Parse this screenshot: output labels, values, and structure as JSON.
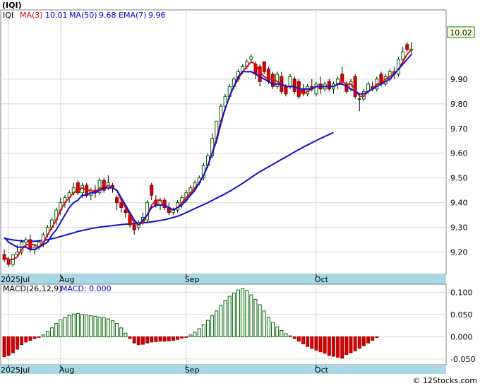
{
  "chart_data": [
    {
      "type": "candlestick",
      "title": "(IQI)",
      "legend": {
        "ticker": "IQI",
        "ma3_label": "MA(3)",
        "ma3_value": "10.01",
        "ma50_label": "MA(50)",
        "ma50_value": "9.68",
        "ema7_label": "EMA(7)",
        "ema7_value": "9.96"
      },
      "last_price_tag": "10.02",
      "ylim": [
        9.11,
        10.18
      ],
      "y_ticks": [
        {
          "value": 9.2,
          "label": "9.20"
        },
        {
          "value": 9.3,
          "label": "9.30"
        },
        {
          "value": 9.4,
          "label": "9.40"
        },
        {
          "value": 9.5,
          "label": "9.50"
        },
        {
          "value": 9.6,
          "label": "9.60"
        },
        {
          "value": 9.7,
          "label": "9.70"
        },
        {
          "value": 9.8,
          "label": "9.80"
        },
        {
          "value": 9.9,
          "label": "9.90"
        }
      ],
      "x_ticks": [
        {
          "label": "2025Jul",
          "bar": 1
        },
        {
          "label": "Aug",
          "bar": 13
        },
        {
          "label": "Sep",
          "bar": 42
        },
        {
          "label": "Oct",
          "bar": 72
        }
      ],
      "ohlc": [
        [
          9.19,
          9.21,
          9.16,
          9.17
        ],
        [
          9.17,
          9.18,
          9.14,
          9.15
        ],
        [
          9.15,
          9.19,
          9.14,
          9.19
        ],
        [
          9.19,
          9.23,
          9.18,
          9.2
        ],
        [
          9.2,
          9.25,
          9.19,
          9.24
        ],
        [
          9.24,
          9.26,
          9.22,
          9.25
        ],
        [
          9.25,
          9.27,
          9.2,
          9.21
        ],
        [
          9.21,
          9.23,
          9.19,
          9.22
        ],
        [
          9.22,
          9.25,
          9.21,
          9.24
        ],
        [
          9.24,
          9.28,
          9.22,
          9.27
        ],
        [
          9.27,
          9.31,
          9.26,
          9.3
        ],
        [
          9.3,
          9.34,
          9.29,
          9.33
        ],
        [
          9.33,
          9.38,
          9.31,
          9.37
        ],
        [
          9.37,
          9.42,
          9.35,
          9.4
        ],
        [
          9.4,
          9.43,
          9.38,
          9.42
        ],
        [
          9.42,
          9.45,
          9.4,
          9.44
        ],
        [
          9.44,
          9.48,
          9.43,
          9.46
        ],
        [
          9.48,
          9.49,
          9.43,
          9.44
        ],
        [
          9.44,
          9.48,
          9.42,
          9.47
        ],
        [
          9.47,
          9.48,
          9.42,
          9.43
        ],
        [
          9.43,
          9.46,
          9.41,
          9.45
        ],
        [
          9.45,
          9.47,
          9.42,
          9.44
        ],
        [
          9.44,
          9.5,
          9.43,
          9.49
        ],
        [
          9.49,
          9.5,
          9.44,
          9.45
        ],
        [
          9.46,
          9.51,
          9.45,
          9.48
        ],
        [
          9.47,
          9.48,
          9.44,
          9.46
        ],
        [
          9.42,
          9.43,
          9.37,
          9.4
        ],
        [
          9.4,
          9.42,
          9.36,
          9.38
        ],
        [
          9.37,
          9.38,
          9.34,
          9.36
        ],
        [
          9.35,
          9.36,
          9.3,
          9.31
        ],
        [
          9.31,
          9.33,
          9.27,
          9.29
        ],
        [
          9.3,
          9.33,
          9.29,
          9.32
        ],
        [
          9.32,
          9.36,
          9.31,
          9.34
        ],
        [
          9.33,
          9.41,
          9.32,
          9.4
        ],
        [
          9.47,
          9.48,
          9.41,
          9.43
        ],
        [
          9.41,
          9.43,
          9.38,
          9.39
        ],
        [
          9.39,
          9.42,
          9.37,
          9.41
        ],
        [
          9.41,
          9.42,
          9.37,
          9.38
        ],
        [
          9.38,
          9.4,
          9.35,
          9.36
        ],
        [
          9.36,
          9.38,
          9.35,
          9.37
        ],
        [
          9.37,
          9.41,
          9.36,
          9.4
        ],
        [
          9.4,
          9.43,
          9.38,
          9.42
        ],
        [
          9.41,
          9.45,
          9.4,
          9.44
        ],
        [
          9.44,
          9.47,
          9.43,
          9.46
        ],
        [
          9.46,
          9.49,
          9.45,
          9.48
        ],
        [
          9.48,
          9.51,
          9.47,
          9.5
        ],
        [
          9.5,
          9.56,
          9.49,
          9.55
        ],
        [
          9.55,
          9.6,
          9.54,
          9.59
        ],
        [
          9.59,
          9.68,
          9.58,
          9.66
        ],
        [
          9.66,
          9.73,
          9.64,
          9.73
        ],
        [
          9.73,
          9.8,
          9.71,
          9.79
        ],
        [
          9.79,
          9.84,
          9.77,
          9.83
        ],
        [
          9.83,
          9.88,
          9.82,
          9.87
        ],
        [
          9.87,
          9.91,
          9.86,
          9.9
        ],
        [
          9.9,
          9.94,
          9.89,
          9.93
        ],
        [
          9.93,
          9.96,
          9.92,
          9.95
        ],
        [
          9.95,
          9.98,
          9.94,
          9.97
        ],
        [
          9.98,
          10.0,
          9.97,
          9.99
        ],
        [
          9.96,
          9.97,
          9.9,
          9.92
        ],
        [
          9.95,
          9.96,
          9.87,
          9.89
        ],
        [
          9.97,
          9.97,
          9.92,
          9.93
        ],
        [
          9.94,
          9.95,
          9.88,
          9.89
        ],
        [
          9.92,
          9.93,
          9.86,
          9.87
        ],
        [
          9.87,
          9.93,
          9.86,
          9.92
        ],
        [
          9.91,
          9.93,
          9.84,
          9.85
        ],
        [
          9.87,
          9.88,
          9.83,
          9.84
        ],
        [
          9.87,
          9.92,
          9.86,
          9.91
        ],
        [
          9.9,
          9.91,
          9.84,
          9.85
        ],
        [
          9.89,
          9.9,
          9.82,
          9.83
        ],
        [
          9.86,
          9.88,
          9.83,
          9.84
        ],
        [
          9.84,
          9.88,
          9.83,
          9.87
        ],
        [
          9.87,
          9.9,
          9.85,
          9.86
        ],
        [
          9.84,
          9.89,
          9.83,
          9.88
        ],
        [
          9.88,
          9.91,
          9.84,
          9.86
        ],
        [
          9.86,
          9.89,
          9.85,
          9.88
        ],
        [
          9.89,
          9.9,
          9.85,
          9.86
        ],
        [
          9.86,
          9.89,
          9.84,
          9.88
        ],
        [
          9.88,
          9.91,
          9.86,
          9.9
        ],
        [
          9.92,
          9.95,
          9.88,
          9.89
        ],
        [
          9.88,
          9.89,
          9.84,
          9.85
        ],
        [
          9.86,
          9.9,
          9.85,
          9.89
        ],
        [
          9.91,
          9.92,
          9.82,
          9.83
        ],
        [
          9.82,
          9.84,
          9.77,
          9.82
        ],
        [
          9.82,
          9.86,
          9.81,
          9.85
        ],
        [
          9.85,
          9.89,
          9.84,
          9.88
        ],
        [
          9.87,
          9.89,
          9.85,
          9.86
        ],
        [
          9.86,
          9.91,
          9.85,
          9.9
        ],
        [
          9.92,
          9.93,
          9.87,
          9.88
        ],
        [
          9.88,
          9.92,
          9.87,
          9.91
        ],
        [
          9.9,
          9.94,
          9.89,
          9.93
        ],
        [
          9.93,
          9.95,
          9.9,
          9.92
        ],
        [
          9.92,
          9.99,
          9.91,
          9.98
        ],
        [
          9.98,
          10.03,
          9.97,
          10.01
        ],
        [
          10.04,
          10.05,
          10.01,
          10.02
        ],
        [
          10.02,
          10.05,
          10.0,
          10.02
        ]
      ],
      "ma3": [
        9.18,
        9.17,
        9.17,
        9.18,
        9.21,
        9.23,
        9.23,
        9.23,
        9.22,
        9.24,
        9.27,
        9.3,
        9.33,
        9.37,
        9.4,
        9.42,
        9.44,
        9.45,
        9.46,
        9.45,
        9.45,
        9.44,
        9.46,
        9.46,
        9.47,
        9.46,
        9.45,
        9.41,
        9.38,
        9.35,
        9.32,
        9.31,
        9.32,
        9.35,
        9.39,
        9.41,
        9.41,
        9.39,
        9.38,
        9.37,
        9.38,
        9.4,
        9.42,
        9.44,
        9.46,
        9.48,
        9.51,
        9.55,
        9.6,
        9.66,
        9.73,
        9.78,
        9.83,
        9.87,
        9.9,
        9.93,
        9.95,
        9.97,
        9.96,
        9.93,
        9.91,
        9.9,
        9.9,
        9.89,
        9.88,
        9.87,
        9.87,
        9.87,
        9.86,
        9.84,
        9.85,
        9.86,
        9.87,
        9.87,
        9.87,
        9.87,
        9.87,
        9.88,
        9.89,
        9.88,
        9.88,
        9.86,
        9.83,
        9.83,
        9.85,
        9.86,
        9.88,
        9.88,
        9.9,
        9.91,
        9.92,
        9.94,
        9.97,
        10.0,
        10.02
      ],
      "ema7": [
        9.26,
        9.24,
        9.23,
        9.22,
        9.22,
        9.22,
        9.21,
        9.21,
        9.22,
        9.23,
        9.24,
        9.27,
        9.29,
        9.32,
        9.35,
        9.38,
        9.4,
        9.41,
        9.43,
        9.43,
        9.44,
        9.44,
        9.45,
        9.46,
        9.46,
        9.46,
        9.45,
        9.42,
        9.39,
        9.36,
        9.33,
        9.31,
        9.33,
        9.35,
        9.38,
        9.39,
        9.39,
        9.39,
        9.38,
        9.37,
        9.38,
        9.39,
        9.41,
        9.43,
        9.45,
        9.48,
        9.51,
        9.55,
        9.6,
        9.65,
        9.72,
        9.78,
        9.83,
        9.87,
        9.91,
        9.93,
        9.93,
        9.93,
        9.92,
        9.91,
        9.9,
        9.89,
        9.88,
        9.88,
        9.88,
        9.87,
        9.87,
        9.87,
        9.86,
        9.86,
        9.86,
        9.86,
        9.87,
        9.87,
        9.87,
        9.87,
        9.87,
        9.88,
        9.88,
        9.87,
        9.86,
        9.85,
        9.84,
        9.84,
        9.85,
        9.86,
        9.87,
        9.88,
        9.89,
        9.9,
        9.92,
        9.94,
        9.96,
        9.98,
        10.0
      ],
      "ma50": [
        9.255,
        9.252,
        9.249,
        9.247,
        9.245,
        9.244,
        9.244,
        9.244,
        9.245,
        9.247,
        9.25,
        9.254,
        9.258,
        9.263,
        9.268,
        9.273,
        9.278,
        9.283,
        9.287,
        9.291,
        9.295,
        9.298,
        9.301,
        9.303,
        9.305,
        9.307,
        9.309,
        9.311,
        9.313,
        9.314,
        9.315,
        9.316,
        9.318,
        9.32,
        9.322,
        9.325,
        9.328,
        9.331,
        9.335,
        9.34,
        9.345,
        9.352,
        9.36,
        9.368,
        9.376,
        9.384,
        9.392,
        9.4,
        9.409,
        9.418,
        9.427,
        9.436,
        9.446,
        9.456,
        9.467,
        9.478,
        9.49,
        9.502,
        9.514,
        9.525,
        9.535,
        9.545,
        9.555,
        9.565,
        9.575,
        9.585,
        9.595,
        9.605,
        9.615,
        9.624,
        9.633,
        9.642,
        9.651,
        9.66,
        9.668,
        9.676,
        9.684
      ]
    },
    {
      "type": "bar",
      "title": "MACD(26,12,9)",
      "value_label": "MACD: 0.000",
      "ylim": [
        -0.063,
        0.118
      ],
      "y_ticks": [
        {
          "value": 0.1,
          "label": "0.100"
        },
        {
          "value": 0.05,
          "label": "0.050"
        },
        {
          "value": 0.0,
          "label": "0.000"
        },
        {
          "value": -0.05,
          "label": "-0.050"
        }
      ],
      "x_ticks": [
        {
          "label": "2025Jul",
          "bar": 1
        },
        {
          "label": "Aug",
          "bar": 13
        },
        {
          "label": "Sep",
          "bar": 42
        },
        {
          "label": "Oct",
          "bar": 72
        }
      ],
      "values": [
        -0.045,
        -0.042,
        -0.036,
        -0.028,
        -0.018,
        -0.012,
        -0.008,
        -0.004,
        -0.001,
        0.004,
        0.012,
        0.02,
        0.03,
        0.038,
        0.043,
        0.048,
        0.051,
        0.052,
        0.05,
        0.049,
        0.047,
        0.046,
        0.044,
        0.043,
        0.04,
        0.036,
        0.03,
        0.02,
        0.008,
        -0.004,
        -0.014,
        -0.018,
        -0.017,
        -0.014,
        -0.012,
        -0.011,
        -0.01,
        -0.01,
        -0.009,
        -0.008,
        -0.006,
        -0.003,
        -0.001,
        0.004,
        0.01,
        0.018,
        0.027,
        0.037,
        0.047,
        0.058,
        0.07,
        0.082,
        0.091,
        0.098,
        0.105,
        0.108,
        0.104,
        0.094,
        0.084,
        0.072,
        0.058,
        0.044,
        0.032,
        0.022,
        0.014,
        0.007,
        0.002,
        -0.004,
        -0.01,
        -0.016,
        -0.022,
        -0.026,
        -0.03,
        -0.034,
        -0.037,
        -0.042,
        -0.044,
        -0.046,
        -0.048,
        -0.04,
        -0.036,
        -0.032,
        -0.026,
        -0.02,
        -0.014,
        -0.008,
        -0.002
      ]
    }
  ],
  "footer": {
    "watermark": "© 12Stocks.com"
  }
}
